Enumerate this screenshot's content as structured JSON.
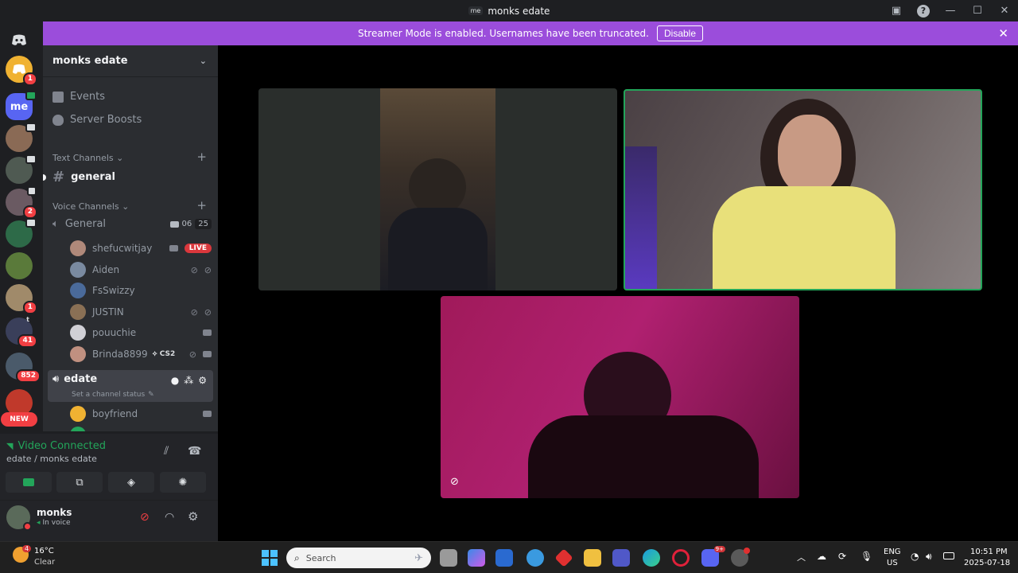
{
  "window": {
    "server_badge": "me",
    "title": "monks edate"
  },
  "banner": {
    "text": "Streamer Mode is enabled. Usernames have been truncated.",
    "button": "Disable"
  },
  "guilds": {
    "me_label": "me",
    "badges": [
      "1",
      "2",
      "1",
      "41",
      "852"
    ],
    "tiny_label": "t",
    "new_label": "NEW"
  },
  "server": {
    "name": "monks edate"
  },
  "nav": {
    "events": "Events",
    "boosts": "Server Boosts"
  },
  "text_channels": {
    "header": "Text Channels",
    "general": "general"
  },
  "voice_channels": {
    "header": "Voice Channels",
    "general": {
      "name": "General",
      "video_count": "06",
      "user_count": "25"
    },
    "users": [
      {
        "name": "shefucwitjay",
        "live": "LIVE"
      },
      {
        "name": "Aiden"
      },
      {
        "name": "FsSwizzy"
      },
      {
        "name": "JUSTIN"
      },
      {
        "name": "pouuchie"
      },
      {
        "name": "Brinda8899",
        "game": "CS2"
      }
    ],
    "edate": {
      "name": "edate",
      "status": "Set a channel status",
      "user": "boyfriend"
    }
  },
  "voice_panel": {
    "status": "Video Connected",
    "location": "edate / monks edate"
  },
  "user_panel": {
    "name": "monks",
    "status": "In voice"
  },
  "weather": {
    "temp": "16°C",
    "desc": "Clear",
    "badge": "4"
  },
  "taskbar": {
    "search_placeholder": "Search",
    "lang": "ENG",
    "region": "US",
    "time": "10:51 PM",
    "date": "2025-07-18",
    "discord_badge": "9+"
  },
  "colors": {
    "blurple": "#5865f2",
    "banner": "#9b4ddb",
    "green": "#23a55a",
    "red": "#f23f43"
  }
}
